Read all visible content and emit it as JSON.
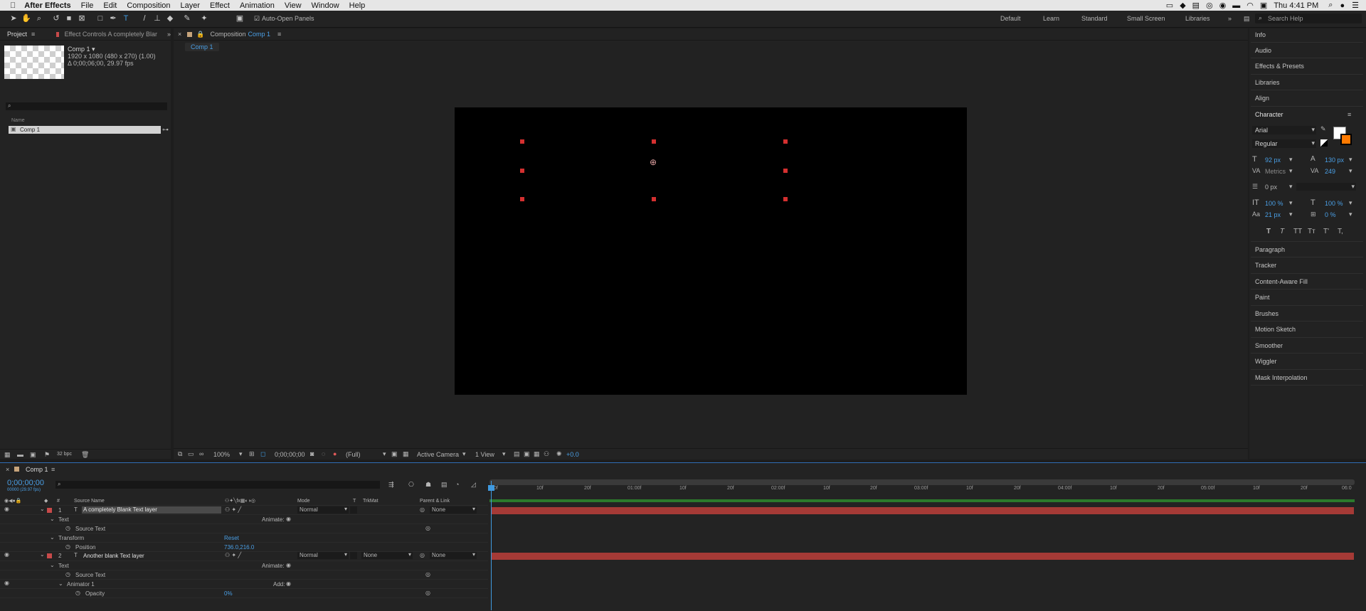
{
  "menubar": {
    "app": "After Effects",
    "items": [
      "File",
      "Edit",
      "Composition",
      "Layer",
      "Effect",
      "Animation",
      "View",
      "Window",
      "Help"
    ],
    "clock": "Thu 4:41 PM"
  },
  "toolbar": {
    "auto_open": "Auto-Open Panels",
    "workspaces": [
      "Default",
      "Learn",
      "Standard",
      "Small Screen",
      "Libraries"
    ],
    "search_placeholder": "Search Help"
  },
  "project": {
    "tab": "Project",
    "effect_tab": "Effect Controls A completely Blar",
    "comp_name": "Comp 1 ▾",
    "comp_info1": "1920 x 1080 (480 x 270) (1.00)",
    "comp_info2": "Δ 0;00;06;00, 29.97 fps",
    "col_name": "Name",
    "item": "Comp 1",
    "bpc": "32 bpc"
  },
  "composition": {
    "tab_prefix": "Composition",
    "tab_comp": "Comp 1",
    "sub_tab": "Comp 1",
    "zoom": "100%",
    "timecode": "0;00;00;00",
    "resolution": "(Full)",
    "camera": "Active Camera",
    "view": "1 View",
    "exposure": "+0.0"
  },
  "right_panel": {
    "items_top": [
      "Info",
      "Audio",
      "Effects & Presets",
      "Libraries",
      "Align"
    ],
    "character_title": "Character",
    "font": "Arial",
    "style": "Regular",
    "size": "92 px",
    "leading": "130 px",
    "kerning": "Metrics",
    "tracking": "249",
    "stroke": "0 px",
    "vscale": "100 %",
    "hscale": "100 %",
    "baseline": "21 px",
    "tsume": "0 %",
    "styles": [
      "T",
      "T",
      "TT",
      "Tт",
      "T'",
      "T,"
    ],
    "items_bottom": [
      "Paragraph",
      "Tracker",
      "Content-Aware Fill",
      "Paint",
      "Brushes",
      "Motion Sketch",
      "Smoother",
      "Wiggler",
      "Mask Interpolation"
    ],
    "accent": "#ff7a00"
  },
  "timeline": {
    "tab": "Comp 1",
    "timecode": "0;00;00;00",
    "fps": "00000 (29.97 fps)",
    "headers": {
      "num": "#",
      "source": "Source Name",
      "mode": "Mode",
      "t": "T",
      "trkmat": "TrkMat",
      "parent": "Parent & Link"
    },
    "layer1": {
      "num": "1",
      "name": "A completely Blank Text layer",
      "mode": "Normal",
      "parent": "None"
    },
    "layer2": {
      "num": "2",
      "name": "Another blank  Text layer",
      "mode": "Normal",
      "trkmat": "None",
      "parent": "None"
    },
    "text": "Text",
    "animate": "Animate:",
    "source_text": "Source Text",
    "transform": "Transform",
    "reset": "Reset",
    "position": "Position",
    "position_value": "736.0,216.0",
    "animator": "Animator 1",
    "add": "Add:",
    "opacity": "Opacity",
    "opacity_value": "0%",
    "ruler": [
      "0f",
      "10f",
      "20f",
      "01:00f",
      "10f",
      "20f",
      "02:00f",
      "10f",
      "20f",
      "03:00f",
      "10f",
      "20f",
      "04:00f",
      "10f",
      "20f",
      "05:00f",
      "10f",
      "20f",
      "06:0"
    ],
    "label_color": "#c84a4a",
    "bar_color": "#a53a36"
  }
}
